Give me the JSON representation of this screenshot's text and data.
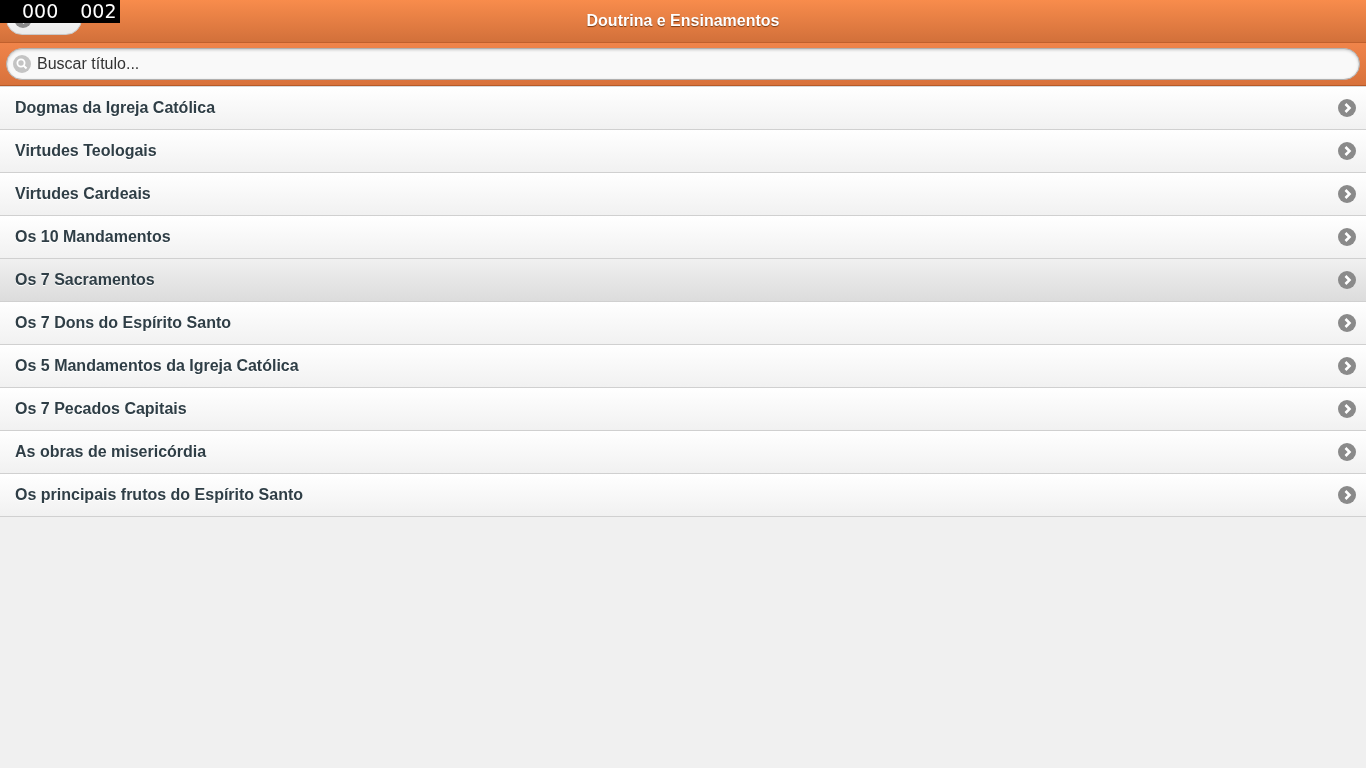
{
  "counter": [
    "000",
    "002"
  ],
  "header": {
    "title": "Doutrina e Ensinamentos"
  },
  "search": {
    "placeholder": "Buscar título..."
  },
  "items": [
    {
      "label": "Dogmas da Igreja Católica",
      "selected": false
    },
    {
      "label": "Virtudes Teologais",
      "selected": false
    },
    {
      "label": "Virtudes Cardeais",
      "selected": false
    },
    {
      "label": "Os 10 Mandamentos",
      "selected": false
    },
    {
      "label": "Os 7 Sacramentos",
      "selected": true
    },
    {
      "label": "Os 7 Dons do Espírito Santo",
      "selected": false
    },
    {
      "label": "Os 5 Mandamentos da Igreja Católica",
      "selected": false
    },
    {
      "label": "Os 7 Pecados Capitais",
      "selected": false
    },
    {
      "label": "As obras de misericórdia",
      "selected": false
    },
    {
      "label": "Os principais frutos do Espírito Santo",
      "selected": false
    }
  ]
}
